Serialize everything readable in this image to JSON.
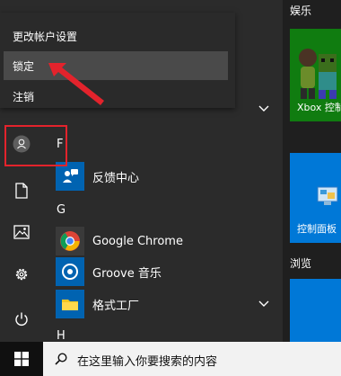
{
  "account_menu": {
    "items": [
      {
        "label": "更改帐户设置"
      },
      {
        "label": "锁定"
      },
      {
        "label": "注销"
      }
    ]
  },
  "app_list": {
    "letters": [
      "F",
      "G",
      "H"
    ],
    "apps": [
      {
        "name": "反馈中心",
        "icon": "feedback-icon",
        "color": "#0063b1"
      },
      {
        "name": "Google Chrome",
        "icon": "chrome-icon",
        "color": "#3a3a3a"
      },
      {
        "name": "Groove 音乐",
        "icon": "groove-icon",
        "color": "#0063b1"
      },
      {
        "name": "格式工厂",
        "icon": "folder-icon",
        "color": "#0063b1"
      }
    ]
  },
  "tiles": {
    "entertainment_header": "娱乐",
    "browse_header": "浏览",
    "xbox_label": "Xbox 控制",
    "control_panel_label": "控制面板"
  },
  "taskbar": {
    "search_placeholder": "在这里输入你要搜索的内容"
  },
  "colors": {
    "accent": "#0078d7",
    "xbox_green": "#107c10",
    "annotation_red": "#e3232c"
  }
}
